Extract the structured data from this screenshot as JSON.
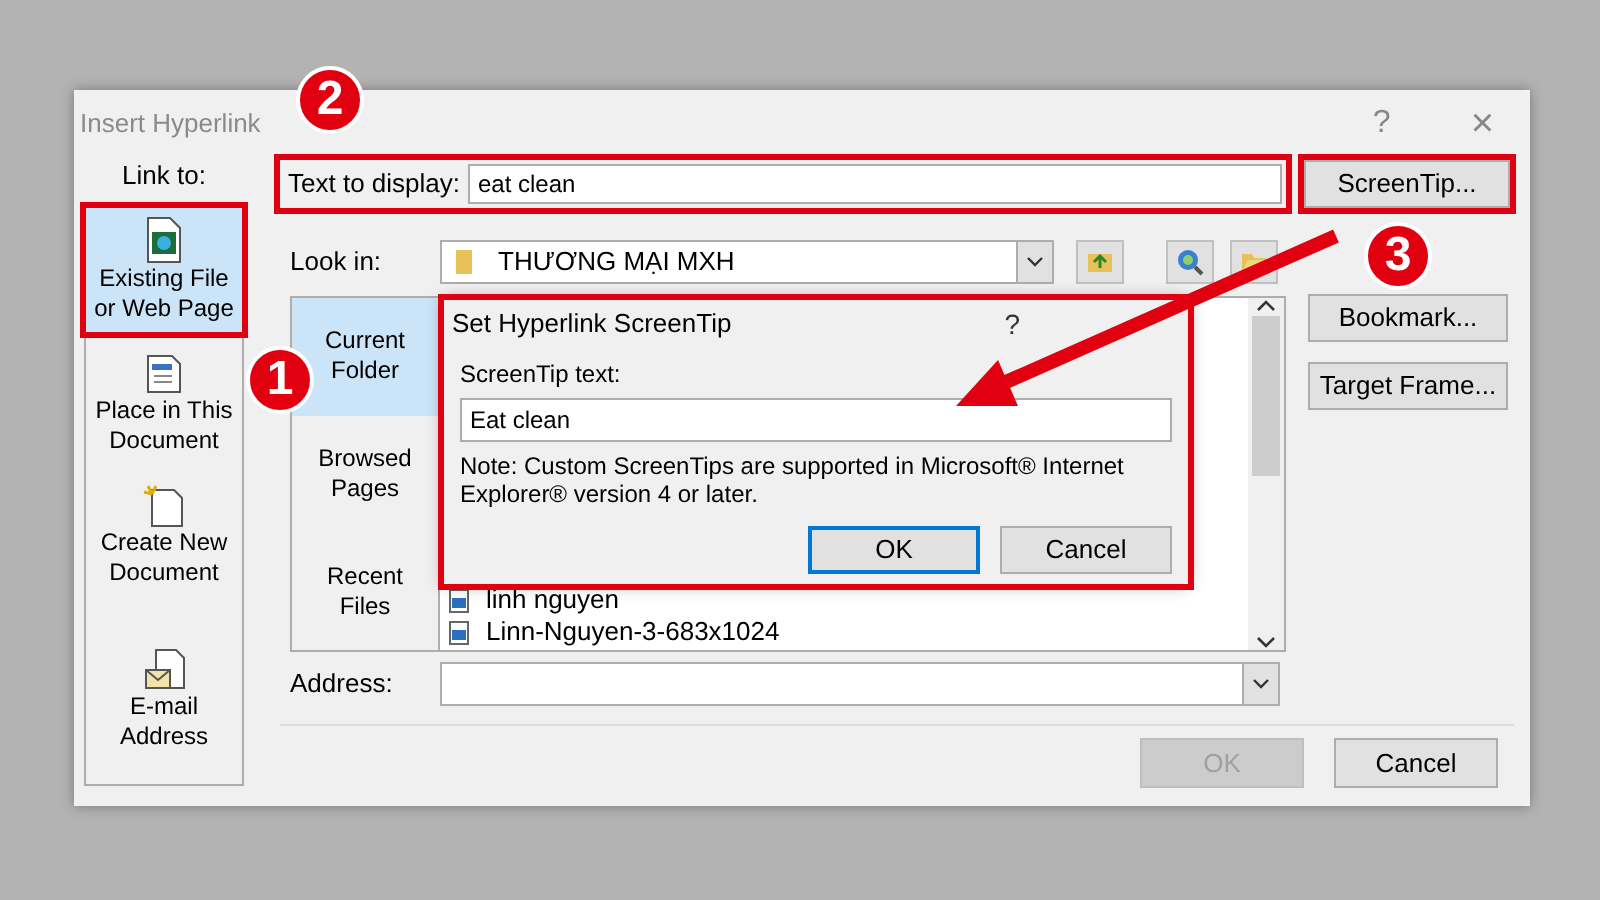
{
  "window": {
    "title": "Insert Hyperlink",
    "help": "?",
    "close": "×"
  },
  "link_to": {
    "label": "Link to:",
    "items": [
      {
        "label": "Existing File or Web Page",
        "kind": "file",
        "selected": true,
        "highlighted": true
      },
      {
        "label": "Place in This Document",
        "kind": "place",
        "selected": false,
        "highlighted": false
      },
      {
        "label": "Create New Document",
        "kind": "new",
        "selected": false,
        "highlighted": false
      },
      {
        "label": "E-mail Address",
        "kind": "email",
        "selected": false,
        "highlighted": false
      }
    ]
  },
  "text_to_display": {
    "label": "Text to display:",
    "value": "eat clean",
    "highlighted": true
  },
  "look_in": {
    "label": "Look in:",
    "value": "THƯƠNG MẠI MXH"
  },
  "side_buttons": [
    {
      "label": "ScreenTip...",
      "highlighted": true
    },
    {
      "label": "Bookmark...",
      "highlighted": false
    },
    {
      "label": "Target Frame...",
      "highlighted": false
    }
  ],
  "browse_tabs": [
    {
      "label": "Current Folder",
      "selected": true
    },
    {
      "label": "Browsed Pages",
      "selected": false
    },
    {
      "label": "Recent Files",
      "selected": false
    }
  ],
  "files": [
    {
      "name": "linh nguyen"
    },
    {
      "name": "Linn-Nguyen-3-683x1024"
    }
  ],
  "address": {
    "label": "Address:"
  },
  "buttons": [
    {
      "label": "OK",
      "disabled": true
    },
    {
      "label": "Cancel",
      "disabled": false
    }
  ],
  "screentip_dialog": {
    "title": "Set Hyperlink ScreenTip",
    "help": "?",
    "field_label": "ScreenTip text:",
    "value": "Eat clean",
    "note": "Note: Custom ScreenTips are supported in Microsoft® Internet Explorer® version 4 or later.",
    "highlighted": true,
    "buttons": [
      {
        "label": "OK",
        "default": true
      },
      {
        "label": "Cancel",
        "default": false
      }
    ]
  },
  "annotations": {
    "badges": [
      "1",
      "2",
      "3"
    ]
  }
}
